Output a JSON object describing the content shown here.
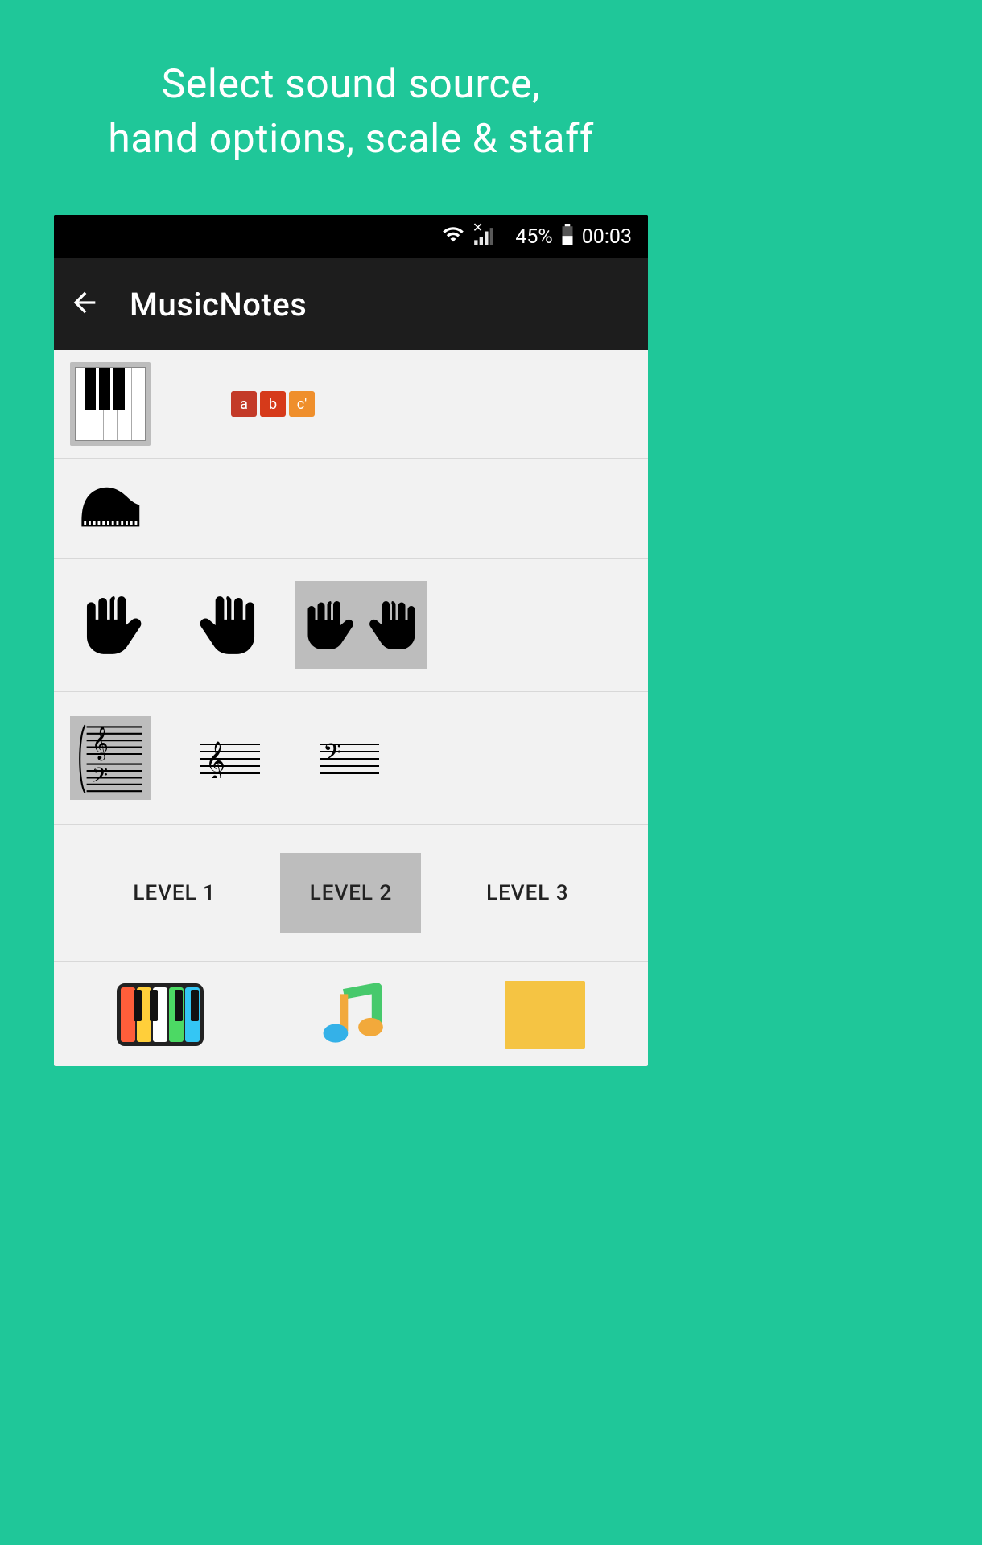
{
  "promo": {
    "line1": "Select sound source,",
    "line2": "hand options, scale & staff"
  },
  "status": {
    "battery_pct": "45%",
    "time": "00:03"
  },
  "appbar": {
    "title": "MusicNotes"
  },
  "sound_row": {
    "notes": [
      "a",
      "b",
      "c'"
    ],
    "selected": "keyboard"
  },
  "instrument_row": {
    "selected": "grand-piano"
  },
  "hands_row": {
    "options": [
      "left",
      "right",
      "both"
    ],
    "selected": "both"
  },
  "staff_row": {
    "options": [
      "grand",
      "treble",
      "bass"
    ],
    "selected": "grand"
  },
  "levels_row": {
    "options": [
      "LEVEL 1",
      "LEVEL 2",
      "LEVEL 3"
    ],
    "selected_index": 1
  },
  "bottom_row": {
    "items": [
      "color-keyboard",
      "music-note",
      "yellow-card"
    ]
  },
  "colors": {
    "brand_teal": "#1fc799",
    "selected_bg": "#bdbdbd",
    "chip_a": "#c33a28",
    "chip_b": "#d63a1a",
    "chip_c": "#ef8f2c"
  }
}
